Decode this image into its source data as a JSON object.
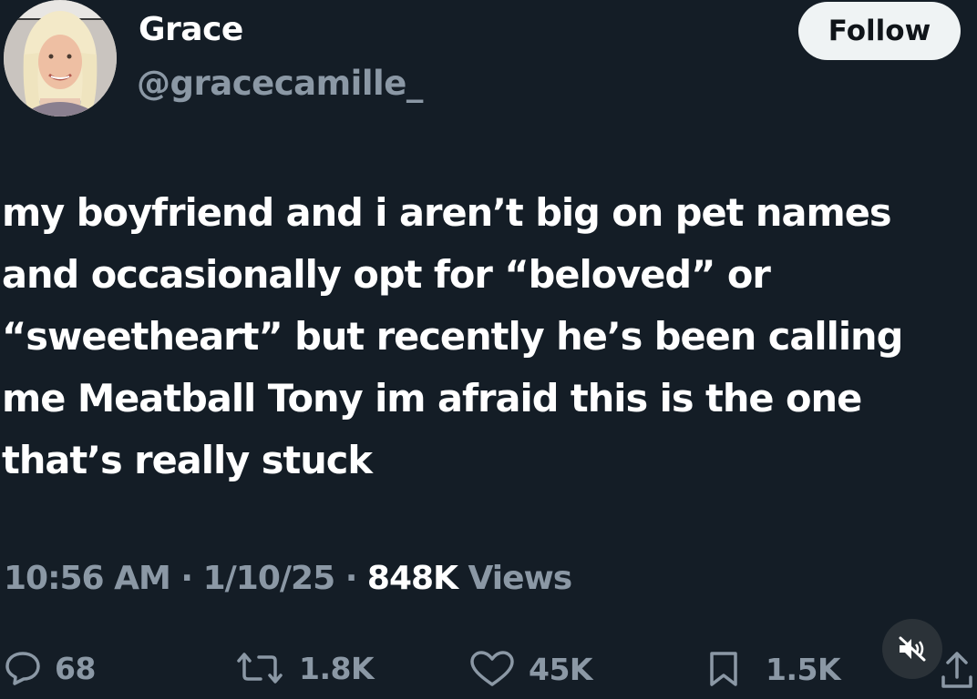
{
  "profile": {
    "display_name": "Grace",
    "handle": "@gracecamille_"
  },
  "follow_button": {
    "label": "Follow"
  },
  "tweet": {
    "lines": [
      "my boyfriend and i aren’t big on pet names",
      "and occasionally opt for “beloved” or",
      "“sweetheart” but recently he’s been calling",
      "me Meatball Tony im afraid this is the one",
      "that’s really stuck"
    ]
  },
  "meta": {
    "time": "10:56 AM",
    "separator": "·",
    "date": "1/10/25",
    "views_count": "848K",
    "views_label": "Views"
  },
  "actions": {
    "replies": "68",
    "reposts": "1.8K",
    "likes": "45K",
    "bookmarks": "1.5K"
  },
  "icons": {
    "reply": "speech-bubble-icon",
    "repost": "repost-arrows-icon",
    "like": "heart-icon",
    "bookmark": "bookmark-icon",
    "mute": "speaker-muted-icon",
    "share": "share-upload-icon"
  },
  "colors": {
    "background": "#141d26",
    "primary_text": "#ffffff",
    "secondary_text": "#8b98a5",
    "follow_button_bg": "#eff3f4"
  }
}
